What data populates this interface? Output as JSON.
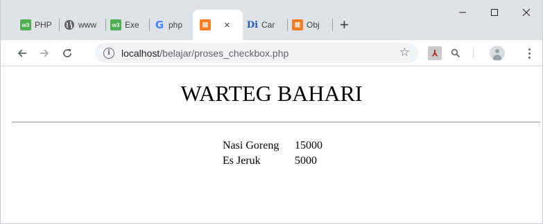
{
  "browser": {
    "tabs": [
      {
        "title": "PHP",
        "icon": "w3schools-icon"
      },
      {
        "title": "www",
        "icon": "globe-icon"
      },
      {
        "title": "Exe",
        "icon": "w3schools-icon"
      },
      {
        "title": "php",
        "icon": "google-icon"
      },
      {
        "title": "",
        "icon": "xampp-icon",
        "active": true
      },
      {
        "title": "Car",
        "icon": "dicoding-icon"
      },
      {
        "title": "Obj",
        "icon": "xampp-icon"
      }
    ],
    "tab_close": "×",
    "new_tab": "+",
    "window_controls": {
      "minimize": "—",
      "maximize": "☐",
      "close": "✕"
    },
    "url_host": "localhost",
    "url_path": "/belajar/proses_checkbox.php",
    "colors": {
      "tabstrip": "#dee1e6",
      "omnibox": "#f1f3f4"
    }
  },
  "page": {
    "title": "WARTEG BAHARI",
    "items": [
      {
        "name": "Nasi Goreng",
        "price": "15000"
      },
      {
        "name": "Es Jeruk",
        "price": "5000"
      }
    ]
  }
}
